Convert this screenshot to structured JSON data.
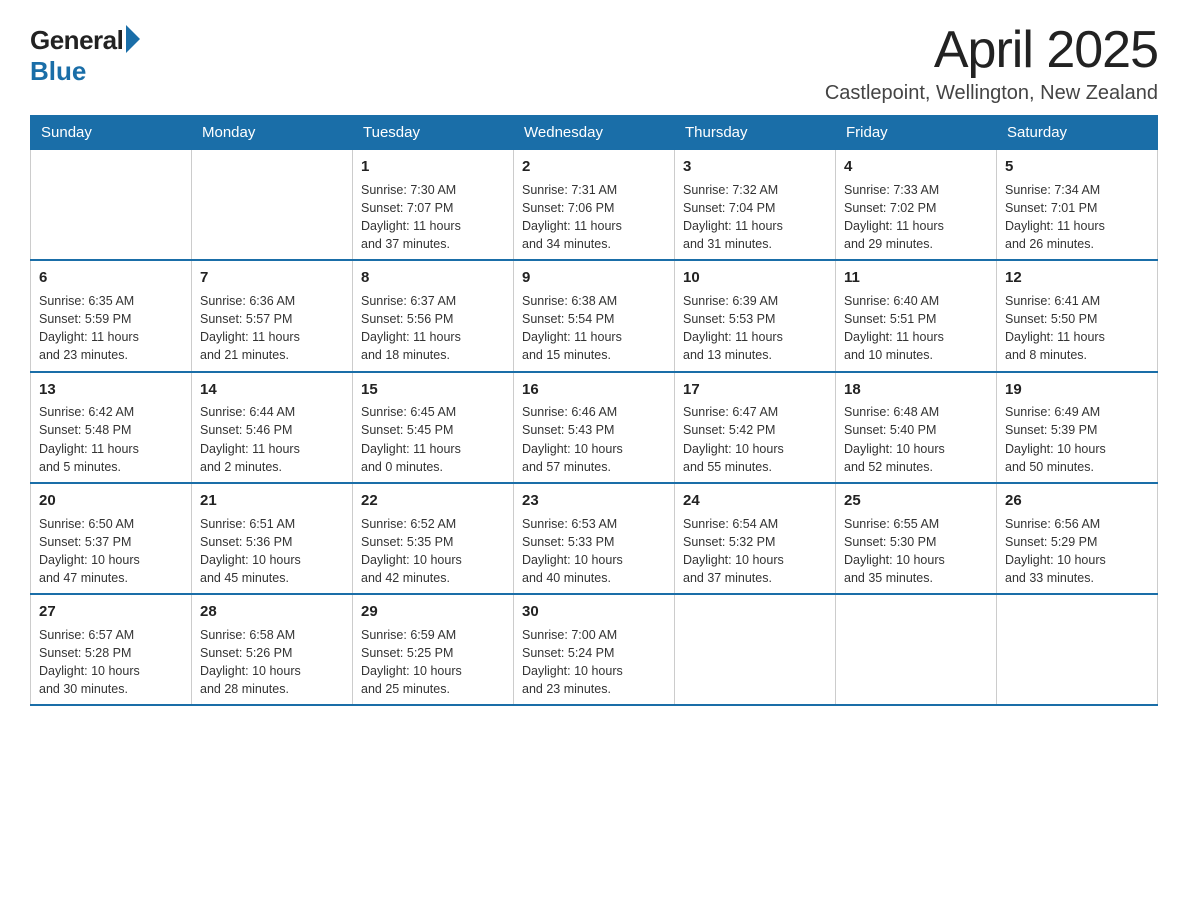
{
  "header": {
    "logo_general": "General",
    "logo_blue": "Blue",
    "title": "April 2025",
    "location": "Castlepoint, Wellington, New Zealand"
  },
  "calendar": {
    "days_of_week": [
      "Sunday",
      "Monday",
      "Tuesday",
      "Wednesday",
      "Thursday",
      "Friday",
      "Saturday"
    ],
    "weeks": [
      [
        {
          "day": "",
          "details": ""
        },
        {
          "day": "",
          "details": ""
        },
        {
          "day": "1",
          "details": "Sunrise: 7:30 AM\nSunset: 7:07 PM\nDaylight: 11 hours\nand 37 minutes."
        },
        {
          "day": "2",
          "details": "Sunrise: 7:31 AM\nSunset: 7:06 PM\nDaylight: 11 hours\nand 34 minutes."
        },
        {
          "day": "3",
          "details": "Sunrise: 7:32 AM\nSunset: 7:04 PM\nDaylight: 11 hours\nand 31 minutes."
        },
        {
          "day": "4",
          "details": "Sunrise: 7:33 AM\nSunset: 7:02 PM\nDaylight: 11 hours\nand 29 minutes."
        },
        {
          "day": "5",
          "details": "Sunrise: 7:34 AM\nSunset: 7:01 PM\nDaylight: 11 hours\nand 26 minutes."
        }
      ],
      [
        {
          "day": "6",
          "details": "Sunrise: 6:35 AM\nSunset: 5:59 PM\nDaylight: 11 hours\nand 23 minutes."
        },
        {
          "day": "7",
          "details": "Sunrise: 6:36 AM\nSunset: 5:57 PM\nDaylight: 11 hours\nand 21 minutes."
        },
        {
          "day": "8",
          "details": "Sunrise: 6:37 AM\nSunset: 5:56 PM\nDaylight: 11 hours\nand 18 minutes."
        },
        {
          "day": "9",
          "details": "Sunrise: 6:38 AM\nSunset: 5:54 PM\nDaylight: 11 hours\nand 15 minutes."
        },
        {
          "day": "10",
          "details": "Sunrise: 6:39 AM\nSunset: 5:53 PM\nDaylight: 11 hours\nand 13 minutes."
        },
        {
          "day": "11",
          "details": "Sunrise: 6:40 AM\nSunset: 5:51 PM\nDaylight: 11 hours\nand 10 minutes."
        },
        {
          "day": "12",
          "details": "Sunrise: 6:41 AM\nSunset: 5:50 PM\nDaylight: 11 hours\nand 8 minutes."
        }
      ],
      [
        {
          "day": "13",
          "details": "Sunrise: 6:42 AM\nSunset: 5:48 PM\nDaylight: 11 hours\nand 5 minutes."
        },
        {
          "day": "14",
          "details": "Sunrise: 6:44 AM\nSunset: 5:46 PM\nDaylight: 11 hours\nand 2 minutes."
        },
        {
          "day": "15",
          "details": "Sunrise: 6:45 AM\nSunset: 5:45 PM\nDaylight: 11 hours\nand 0 minutes."
        },
        {
          "day": "16",
          "details": "Sunrise: 6:46 AM\nSunset: 5:43 PM\nDaylight: 10 hours\nand 57 minutes."
        },
        {
          "day": "17",
          "details": "Sunrise: 6:47 AM\nSunset: 5:42 PM\nDaylight: 10 hours\nand 55 minutes."
        },
        {
          "day": "18",
          "details": "Sunrise: 6:48 AM\nSunset: 5:40 PM\nDaylight: 10 hours\nand 52 minutes."
        },
        {
          "day": "19",
          "details": "Sunrise: 6:49 AM\nSunset: 5:39 PM\nDaylight: 10 hours\nand 50 minutes."
        }
      ],
      [
        {
          "day": "20",
          "details": "Sunrise: 6:50 AM\nSunset: 5:37 PM\nDaylight: 10 hours\nand 47 minutes."
        },
        {
          "day": "21",
          "details": "Sunrise: 6:51 AM\nSunset: 5:36 PM\nDaylight: 10 hours\nand 45 minutes."
        },
        {
          "day": "22",
          "details": "Sunrise: 6:52 AM\nSunset: 5:35 PM\nDaylight: 10 hours\nand 42 minutes."
        },
        {
          "day": "23",
          "details": "Sunrise: 6:53 AM\nSunset: 5:33 PM\nDaylight: 10 hours\nand 40 minutes."
        },
        {
          "day": "24",
          "details": "Sunrise: 6:54 AM\nSunset: 5:32 PM\nDaylight: 10 hours\nand 37 minutes."
        },
        {
          "day": "25",
          "details": "Sunrise: 6:55 AM\nSunset: 5:30 PM\nDaylight: 10 hours\nand 35 minutes."
        },
        {
          "day": "26",
          "details": "Sunrise: 6:56 AM\nSunset: 5:29 PM\nDaylight: 10 hours\nand 33 minutes."
        }
      ],
      [
        {
          "day": "27",
          "details": "Sunrise: 6:57 AM\nSunset: 5:28 PM\nDaylight: 10 hours\nand 30 minutes."
        },
        {
          "day": "28",
          "details": "Sunrise: 6:58 AM\nSunset: 5:26 PM\nDaylight: 10 hours\nand 28 minutes."
        },
        {
          "day": "29",
          "details": "Sunrise: 6:59 AM\nSunset: 5:25 PM\nDaylight: 10 hours\nand 25 minutes."
        },
        {
          "day": "30",
          "details": "Sunrise: 7:00 AM\nSunset: 5:24 PM\nDaylight: 10 hours\nand 23 minutes."
        },
        {
          "day": "",
          "details": ""
        },
        {
          "day": "",
          "details": ""
        },
        {
          "day": "",
          "details": ""
        }
      ]
    ]
  }
}
